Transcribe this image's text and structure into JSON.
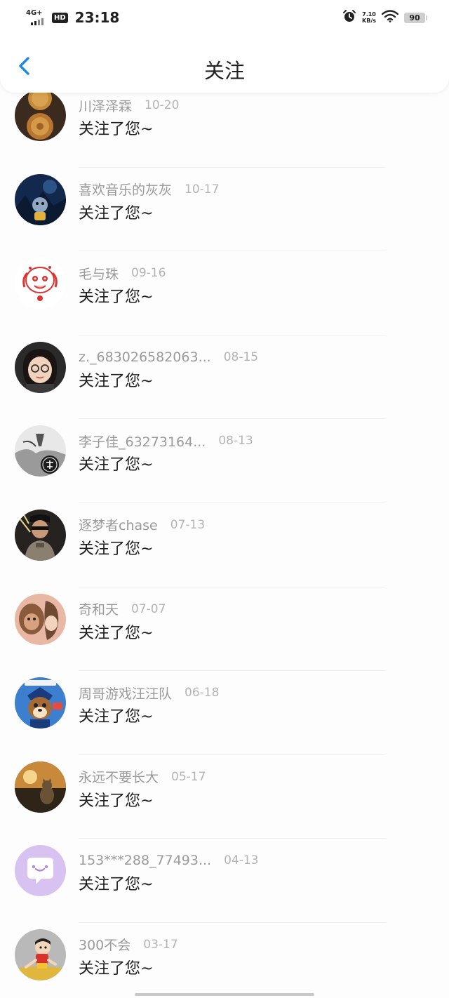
{
  "status_bar": {
    "network": "4G+",
    "hd": "HD",
    "time": "23:18",
    "speed_value": "7.10",
    "speed_unit": "KB/s",
    "battery": "90"
  },
  "header": {
    "back_icon": "chevron-left-icon",
    "title": "关注"
  },
  "colors": {
    "accent": "#1e88e5",
    "name_text": "#9a9a9a",
    "date_text": "#b4b4b4",
    "message_text": "#1e1e1e"
  },
  "notifications": [
    {
      "name": "川泽泽霖",
      "date": "10-20",
      "message": "关注了您~"
    },
    {
      "name": "喜欢音乐的灰灰",
      "date": "10-17",
      "message": "关注了您~"
    },
    {
      "name": "毛与珠",
      "date": "09-16",
      "message": "关注了您~"
    },
    {
      "name": "z._683026582063...",
      "date": "08-15",
      "message": "关注了您~"
    },
    {
      "name": "李子佳_63273164...",
      "date": "08-13",
      "message": "关注了您~"
    },
    {
      "name": "逐梦者chase",
      "date": "07-13",
      "message": "关注了您~"
    },
    {
      "name": "奇和天",
      "date": "07-07",
      "message": "关注了您~"
    },
    {
      "name": "周哥游戏汪汪队",
      "date": "06-18",
      "message": "关注了您~"
    },
    {
      "name": "永远不要长大",
      "date": "05-17",
      "message": "关注了您~"
    },
    {
      "name": "153***288_77493...",
      "date": "04-13",
      "message": "关注了您~"
    },
    {
      "name": "300不会",
      "date": "03-17",
      "message": "关注了您~"
    }
  ]
}
